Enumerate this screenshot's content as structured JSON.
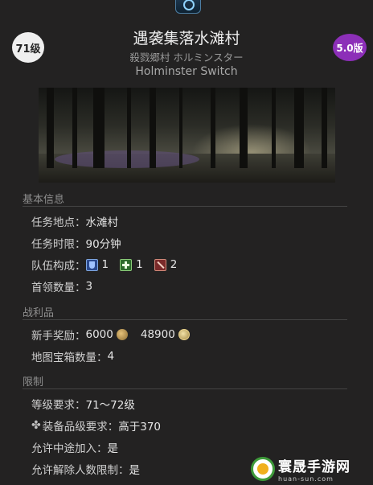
{
  "header": {
    "level_badge": "71级",
    "version_badge": "5.0版",
    "title": "遇袭集落水滩村",
    "subtitle_jp": "殺戮郷村 ホルミンスター",
    "subtitle_en": "Holminster Switch"
  },
  "sections": {
    "basic": {
      "heading": "基本信息",
      "location_label": "任务地点：",
      "location_value": "水滩村",
      "time_label": "任务时限：",
      "time_value": "90分钟",
      "party_label": "队伍构成：",
      "party": {
        "tank_count": "1",
        "healer_count": "1",
        "dps_count": "2"
      },
      "boss_label": "首领数量：",
      "boss_value": "3"
    },
    "loot": {
      "heading": "战利品",
      "reward_label": "新手奖励：",
      "gil_value": "6000",
      "mgp_value": "48900",
      "chest_label": "地图宝箱数量：",
      "chest_value": "4"
    },
    "limits": {
      "heading": "限制",
      "level_req_label": "等级要求：",
      "level_req_value": "71～72级",
      "ilvl_req_label": "装备品级要求：",
      "ilvl_req_value": "高于370",
      "join_in_progress_label": "允许中途加入：",
      "join_in_progress_value": "是",
      "unrestricted_label": "允许解除人数限制：",
      "unrestricted_value": "是"
    }
  },
  "watermark": {
    "title": "寰晟手游网",
    "url": "huan-sun.com"
  },
  "colors": {
    "background": "#232222",
    "version_badge": "#8c2fb8",
    "level_badge": "#efefef"
  }
}
